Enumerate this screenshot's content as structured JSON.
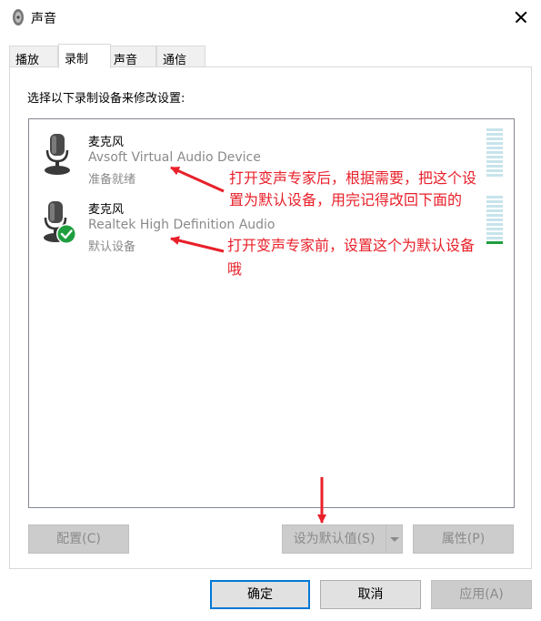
{
  "window": {
    "title": "声音"
  },
  "tabs": [
    {
      "label": "播放"
    },
    {
      "label": "录制"
    },
    {
      "label": "声音"
    },
    {
      "label": "通信"
    }
  ],
  "panel": {
    "instruction": "选择以下录制设备来修改设置:"
  },
  "devices": [
    {
      "name": "麦克风",
      "description": "Avsoft Virtual Audio Device",
      "status": "准备就绪",
      "icon": "microphone-icon",
      "level": 0.0
    },
    {
      "name": "麦克风",
      "description": "Realtek High Definition Audio",
      "status": "默认设备",
      "icon": "microphone-default-icon",
      "level": 0.1
    }
  ],
  "annotations": {
    "note1_line1": "打开变声专家后，根据需要，把这个设",
    "note1_line2": "置为默认设备，用完记得改回下面的",
    "note2_line1": "打开变声专家前，设置这个为默认设备",
    "note2_line2": "哦"
  },
  "panel_buttons": {
    "configure": "配置(C)",
    "set_default": "设为默认值(S)",
    "properties": "属性(P)"
  },
  "dialog_buttons": {
    "ok": "确定",
    "cancel": "取消",
    "apply": "应用(A)"
  },
  "colors": {
    "annotation": "#e8202a",
    "meter_off": "#c7e4ec",
    "meter_on": "#1f9e3f",
    "check_badge": "#1f9e3f",
    "focus_border": "#0078d7"
  }
}
